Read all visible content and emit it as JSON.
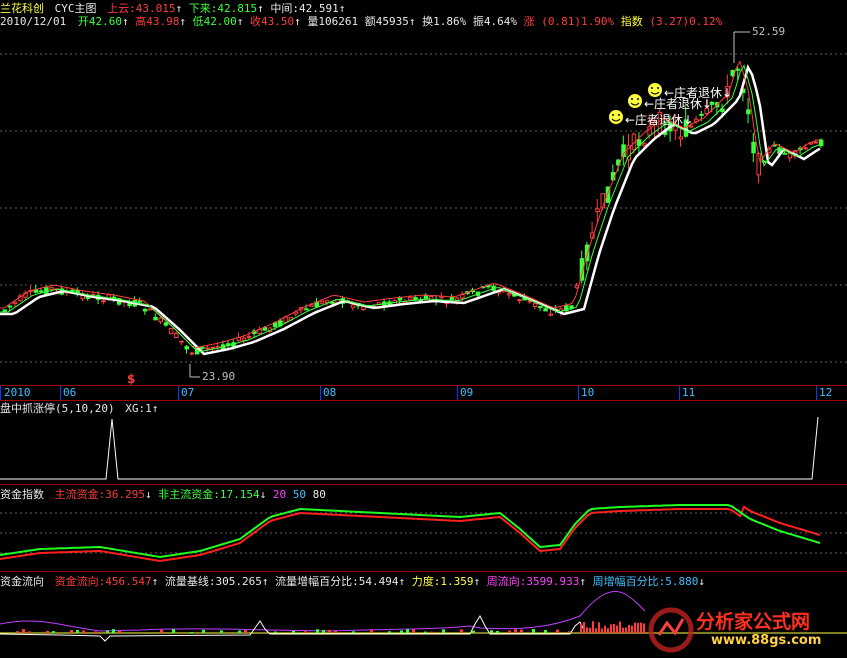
{
  "header": {
    "title": "兰花科创",
    "chart_name": "CYC主图",
    "upper_label": "上云:",
    "upper_val": "43.015",
    "lower_label": "下来:",
    "lower_val": "42.815",
    "mid_label": "中间:",
    "mid_val": "42.591",
    "arrow_up": "↑",
    "arrow_down": "↓"
  },
  "quote": {
    "date": "2010/12/01",
    "open_label": "开",
    "open": "42.60",
    "high_label": "高",
    "high": "43.98",
    "low_label": "低",
    "low": "42.00",
    "close_label": "收",
    "close": "43.50",
    "vol_label": "量",
    "vol": "106261",
    "amt_label": "额",
    "amt": "45935",
    "turn_label": "换",
    "turn": "1.86%",
    "amp_label": "振",
    "amp": "4.64%",
    "chg_label": "涨",
    "chg": "(0.81)",
    "chg_pct": "1.90%",
    "idx_label": "指数",
    "idx": "(3.27)",
    "idx_pct": "0.12%"
  },
  "annotations": {
    "high_price": "52.59",
    "low_price": "23.90",
    "exit_text": "←庄者退休↓",
    "dollar_mark": "$"
  },
  "axis": {
    "labels": [
      "2010",
      "06",
      "07",
      "08",
      "09",
      "10",
      "11",
      "12"
    ]
  },
  "panel2": {
    "title": "盘中抓涨停(5,10,20)",
    "xg_label": "XG:",
    "xg_val": "1",
    "arrow": "↑"
  },
  "panel3": {
    "title": "资金指数",
    "main_label": "主流资金:",
    "main_val": "36.295",
    "nonmain_label": "非主流资金:",
    "nonmain_val": "17.154",
    "lvl20": "20",
    "lvl50": "50",
    "lvl80": "80",
    "arrow_up": "↑",
    "arrow_down": "↓"
  },
  "panel4": {
    "title": "资金流向",
    "flow_label": "资金流向:",
    "flow_val": "456.547",
    "base_label": "流量基线:",
    "base_val": "305.265",
    "incr_label": "流量增幅百分比:",
    "incr_val": "54.494",
    "force_label": "力度:",
    "force_val": "1.359",
    "week_label": "周流向:",
    "week_val": "3599.933",
    "weekpct_label": "周增幅百分比:",
    "weekpct_val": "5.880",
    "arrow_up": "↑",
    "arrow_down": "↓"
  },
  "watermark": {
    "text": "分析家公式网",
    "url": "www.88gs.com"
  },
  "colors": {
    "up": "#ff3b3b",
    "down": "#3cff3c",
    "ma": "#ffffff",
    "grid": "#a00000"
  }
}
